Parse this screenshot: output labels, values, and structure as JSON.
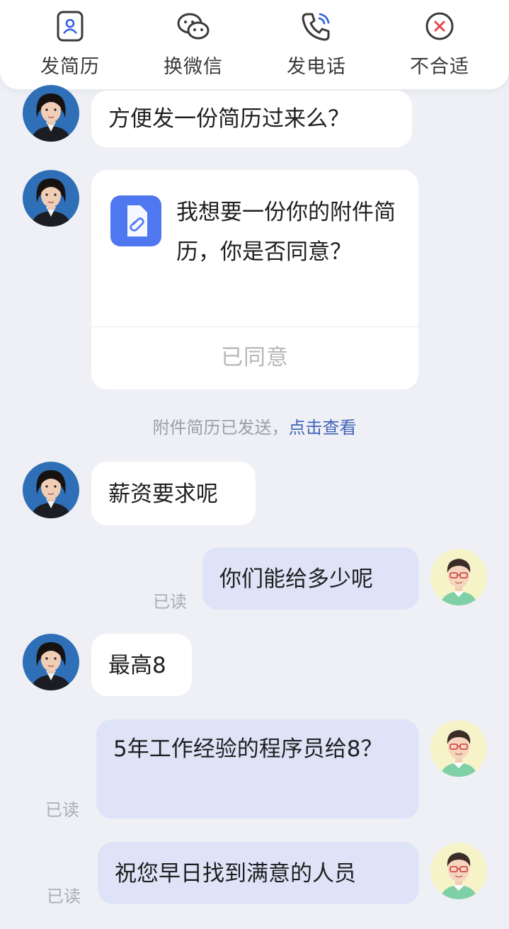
{
  "toolbar": {
    "items": [
      {
        "label": "发简历",
        "icon": "resume-icon"
      },
      {
        "label": "换微信",
        "icon": "wechat-icon"
      },
      {
        "label": "发电话",
        "icon": "phone-icon"
      },
      {
        "label": "不合适",
        "icon": "reject-icon"
      }
    ]
  },
  "messages": [
    {
      "from": "recruiter",
      "text": "方便发一份简历过来么？"
    },
    {
      "from": "recruiter",
      "type": "request-card",
      "text": "我想要一份你的附件简历，你是否同意？",
      "status": "已同意",
      "icon": "attachment-icon"
    },
    {
      "type": "system",
      "text": "附件简历已发送，",
      "link": "点击查看"
    },
    {
      "from": "recruiter",
      "text": "薪资要求呢"
    },
    {
      "from": "me",
      "text": "你们能给多少呢",
      "receipt": "已读"
    },
    {
      "from": "recruiter",
      "text": "最高8"
    },
    {
      "from": "me",
      "text": "5年工作经验的程序员给8？",
      "receipt": "已读"
    },
    {
      "from": "me",
      "text": "祝您早日找到满意的人员",
      "receipt": "已读"
    }
  ],
  "colors": {
    "background": "#eef0f5",
    "incoming_bubble": "#ffffff",
    "outgoing_bubble": "#dee3f8",
    "accent": "#3f62b8",
    "card_icon": "#4f78f0"
  }
}
